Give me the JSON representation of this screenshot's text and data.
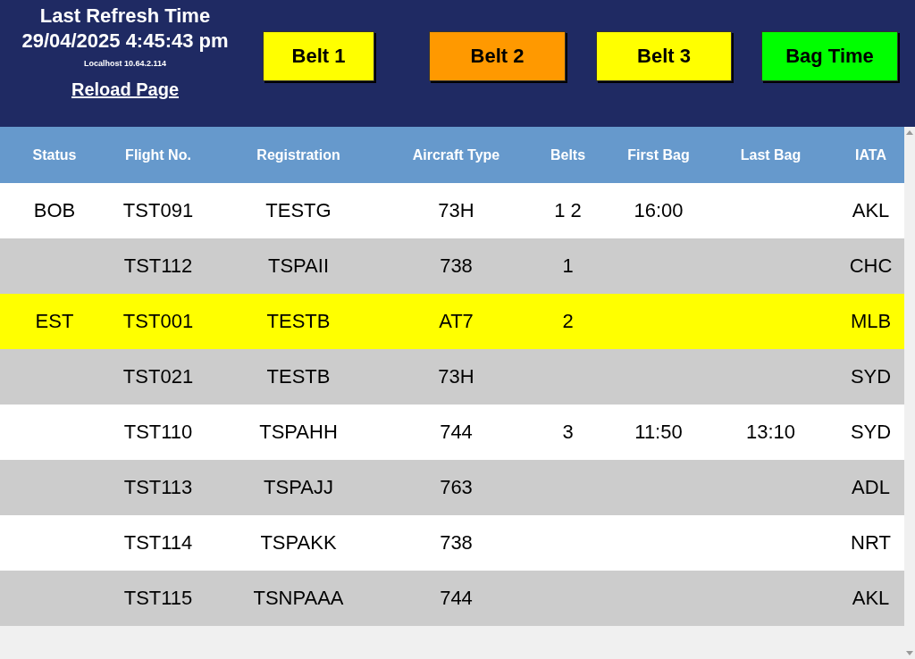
{
  "header": {
    "title": "Last Refresh Time",
    "timestamp": "29/04/2025 4:45:43 pm",
    "host": "Localhost 10.64.2.114",
    "reload_link": "Reload Page"
  },
  "belt_buttons": [
    {
      "label": "Belt 1",
      "color": "#ffff00"
    },
    {
      "label": "Belt 2",
      "color": "#ff9900"
    },
    {
      "label": "Belt 3",
      "color": "#ffff00"
    },
    {
      "label": "Bag Time",
      "color": "#00ff00"
    }
  ],
  "table": {
    "columns": [
      "Status",
      "Flight No.",
      "Registration",
      "Aircraft Type",
      "Belts",
      "First Bag",
      "Last Bag",
      "IATA"
    ],
    "rows": [
      {
        "color": "#ffffff",
        "cells": [
          "BOB",
          "TST091",
          "TESTG",
          "73H",
          "1 2",
          "16:00",
          "",
          "AKL"
        ]
      },
      {
        "color": "#cccccc",
        "cells": [
          "",
          "TST112",
          "TSPAII",
          "738",
          "1",
          "",
          "",
          "CHC"
        ]
      },
      {
        "color": "#ffff00",
        "cells": [
          "EST",
          "TST001",
          "TESTB",
          "AT7",
          "2",
          "",
          "",
          "MLB"
        ]
      },
      {
        "color": "#cccccc",
        "cells": [
          "",
          "TST021",
          "TESTB",
          "73H",
          "",
          "",
          "",
          "SYD"
        ]
      },
      {
        "color": "#ffffff",
        "cells": [
          "",
          "TST110",
          "TSPAHH",
          "744",
          "3",
          "11:50",
          "13:10",
          "SYD"
        ]
      },
      {
        "color": "#cccccc",
        "cells": [
          "",
          "TST113",
          "TSPAJJ",
          "763",
          "",
          "",
          "",
          "ADL"
        ]
      },
      {
        "color": "#ffffff",
        "cells": [
          "",
          "TST114",
          "TSPAKK",
          "738",
          "",
          "",
          "",
          "NRT"
        ]
      },
      {
        "color": "#cccccc",
        "cells": [
          "",
          "TST115",
          "TSNPAAA",
          "744",
          "",
          "",
          "",
          "AKL"
        ]
      }
    ]
  }
}
